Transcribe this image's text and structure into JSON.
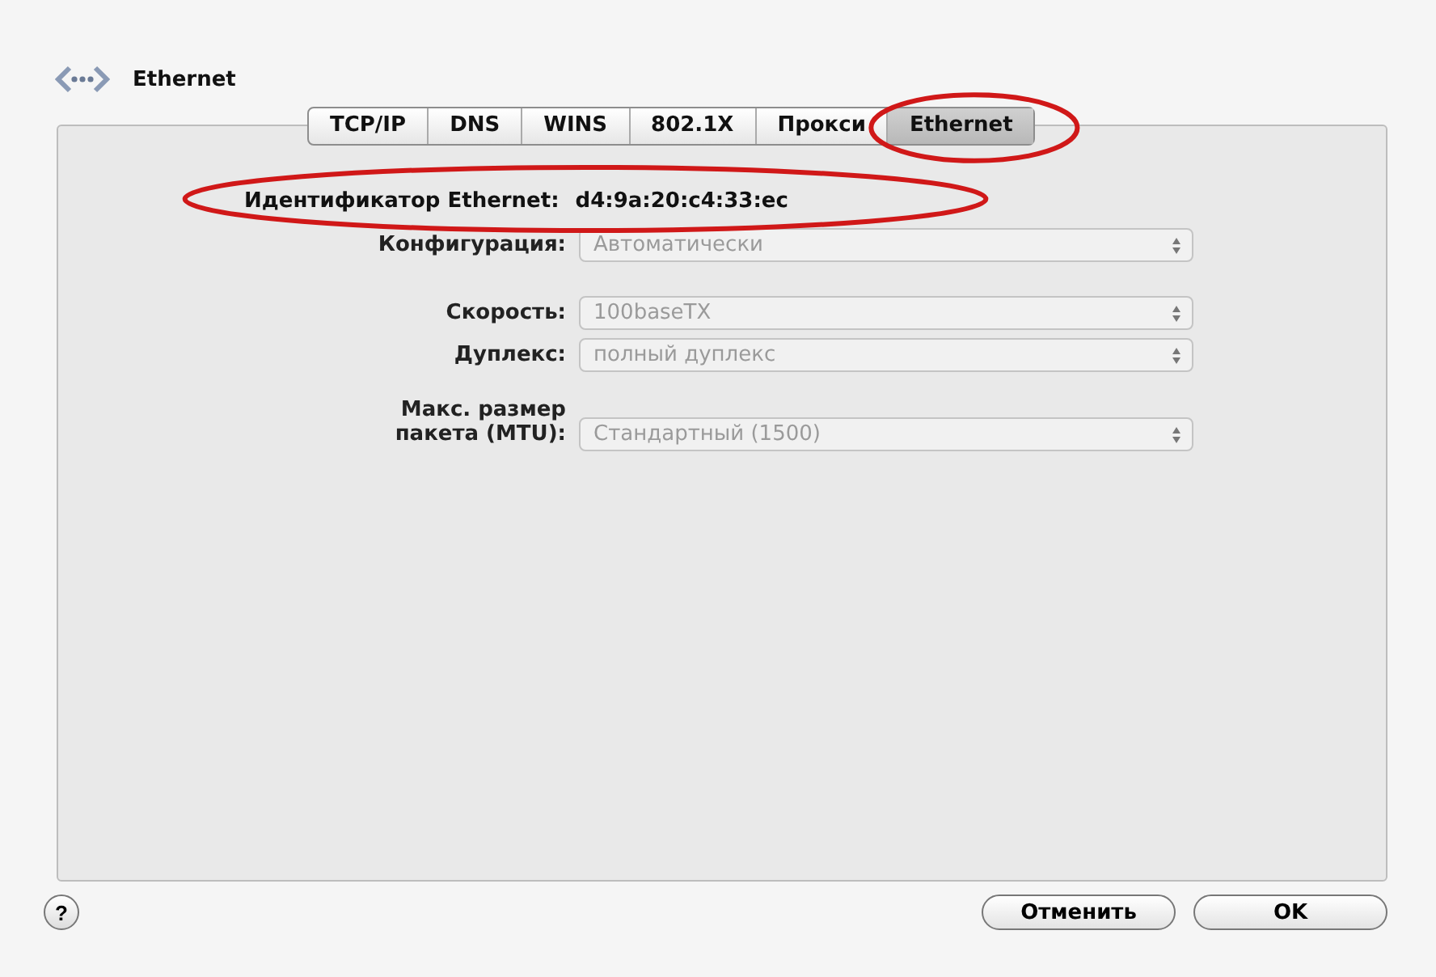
{
  "window": {
    "title": "Ethernet"
  },
  "tabs": [
    {
      "label": "TCP/IP",
      "selected": false,
      "highlighted": false
    },
    {
      "label": "DNS",
      "selected": false,
      "highlighted": false
    },
    {
      "label": "WINS",
      "selected": false,
      "highlighted": false
    },
    {
      "label": "802.1X",
      "selected": false,
      "highlighted": false
    },
    {
      "label": "Прокси",
      "selected": false,
      "highlighted": false
    },
    {
      "label": "Ethernet",
      "selected": true,
      "highlighted": true
    }
  ],
  "ethernet_id": {
    "label": "Идентификатор Ethernet:",
    "value": "d4:9a:20:c4:33:ec",
    "highlighted": true
  },
  "fields": [
    {
      "label": "Конфигурация:",
      "value": "Автоматически",
      "disabled": true
    },
    {
      "label": "Скорость:",
      "value": "100baseTX",
      "disabled": true
    },
    {
      "label": "Дуплекс:",
      "value": "полный дуплекс",
      "disabled": true
    },
    {
      "label": "Макс. размер пакета (MTU):",
      "value": "Стандартный (1500)",
      "disabled": true
    }
  ],
  "help": "?",
  "buttons": [
    {
      "label": "Отменить"
    },
    {
      "label": "OK"
    }
  ]
}
